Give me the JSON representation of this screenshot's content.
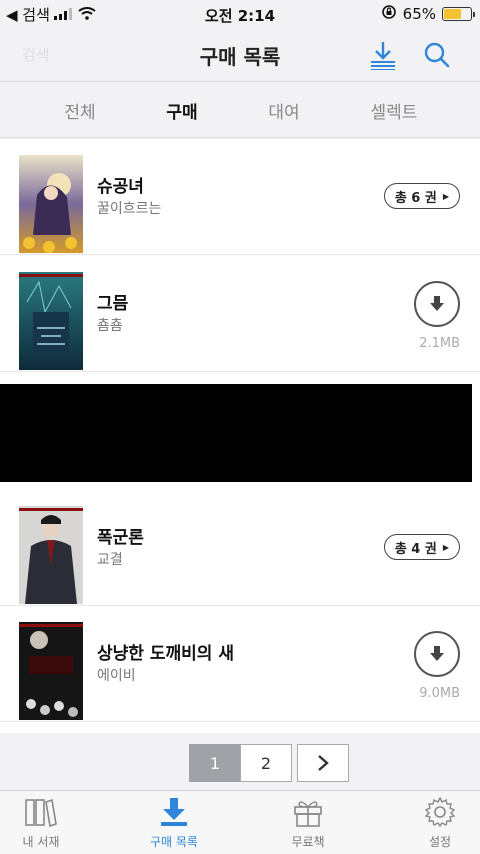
{
  "status": {
    "back_label": "◀ 검색",
    "time": "오전 2:14",
    "battery": "65%",
    "battery_level": 0.65
  },
  "header": {
    "title": "구매 목록",
    "faint_text": "검색"
  },
  "tabs": [
    {
      "label": "전체",
      "active": false
    },
    {
      "label": "구매",
      "active": true
    },
    {
      "label": "대여",
      "active": false
    },
    {
      "label": "셀렉트",
      "active": false
    }
  ],
  "books": [
    {
      "title": "슈공녀",
      "author": "꿀이흐르는",
      "volumes": "총 6 권",
      "cover_text": "슈공녀"
    },
    {
      "title": "그믐",
      "author": "춈춈",
      "size": "2.1MB",
      "cover_text": "그믐"
    },
    {
      "title": "폭군론",
      "author": "교결",
      "volumes": "총 4 권",
      "cover_text": "폭군론"
    },
    {
      "title": "상냥한 도깨비의 새",
      "author": "에이비",
      "size": "9.0MB",
      "cover_text": "상냥한 도깨비의 새"
    }
  ],
  "pagination": {
    "pages": [
      "1",
      "2"
    ],
    "current": "1",
    "next_icon": "chevron-right-icon"
  },
  "bottom_nav": [
    {
      "label": "내 서재",
      "icon": "bookshelf-icon",
      "active": false
    },
    {
      "label": "구매 목록",
      "icon": "download-tray-icon",
      "active": true
    },
    {
      "label": "무료책",
      "icon": "gift-icon",
      "active": false
    },
    {
      "label": "설정",
      "icon": "gear-icon",
      "active": false
    }
  ],
  "colors": {
    "accent": "#2f86d8",
    "battery": "#f4c430",
    "redaction": "#000000"
  }
}
